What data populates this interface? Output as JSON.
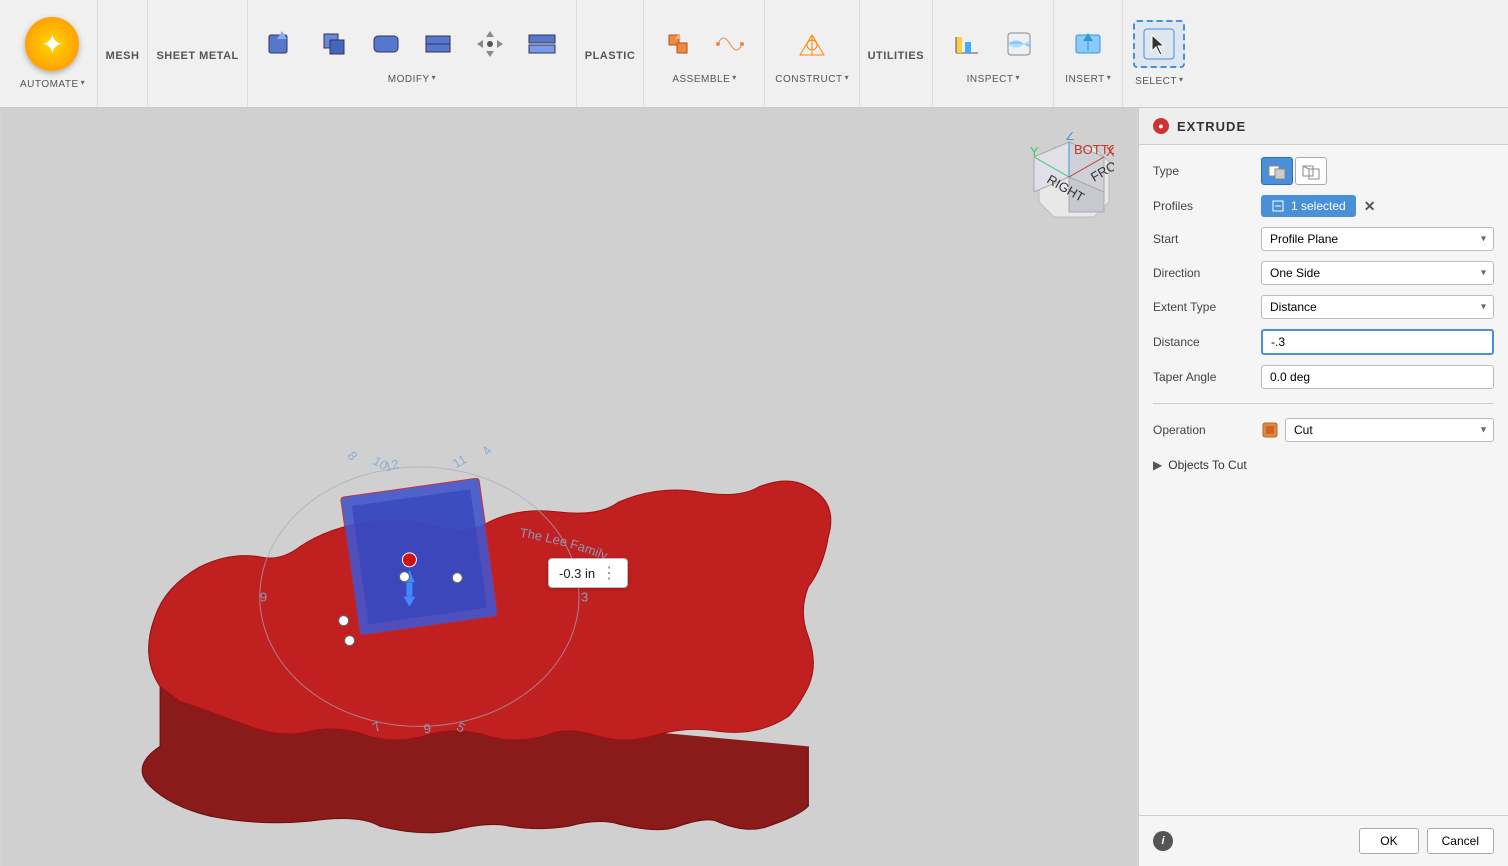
{
  "toolbar": {
    "sections": [
      {
        "id": "automate",
        "label": "AUTOMATE",
        "hasDropdown": true
      },
      {
        "id": "mesh",
        "label": "MESH",
        "buttons": []
      },
      {
        "id": "sheet-metal",
        "label": "SHEET METAL",
        "buttons": []
      },
      {
        "id": "modify",
        "label": "MODIFY",
        "hasDropdown": true,
        "buttons": [
          {
            "id": "mod1",
            "label": ""
          },
          {
            "id": "mod2",
            "label": ""
          },
          {
            "id": "mod3",
            "label": ""
          },
          {
            "id": "mod4",
            "label": ""
          },
          {
            "id": "mod5",
            "label": ""
          },
          {
            "id": "mod6",
            "label": ""
          }
        ]
      },
      {
        "id": "plastic",
        "label": "PLASTIC",
        "buttons": []
      },
      {
        "id": "assemble",
        "label": "ASSEMBLE",
        "hasDropdown": true,
        "buttons": [
          {
            "id": "asm1",
            "label": ""
          },
          {
            "id": "asm2",
            "label": ""
          }
        ]
      },
      {
        "id": "construct",
        "label": "CONSTRUCT",
        "hasDropdown": true,
        "buttons": [
          {
            "id": "con1",
            "label": ""
          }
        ]
      },
      {
        "id": "utilities",
        "label": "UTILITIES",
        "buttons": []
      },
      {
        "id": "inspect",
        "label": "INSPECT",
        "hasDropdown": true,
        "buttons": [
          {
            "id": "ins1",
            "label": ""
          },
          {
            "id": "ins2",
            "label": ""
          }
        ]
      },
      {
        "id": "insert",
        "label": "INSERT",
        "hasDropdown": true,
        "buttons": [
          {
            "id": "ins3",
            "label": ""
          }
        ]
      },
      {
        "id": "select",
        "label": "SELECT",
        "hasDropdown": true,
        "buttons": [
          {
            "id": "sel1",
            "label": ""
          }
        ]
      }
    ]
  },
  "panel": {
    "title": "EXTRUDE",
    "fields": {
      "type": {
        "label": "Type",
        "options": [
          "solid",
          "surface"
        ]
      },
      "profiles": {
        "label": "Profiles",
        "value": "1 selected"
      },
      "start": {
        "label": "Start",
        "value": "Profile Plane"
      },
      "direction": {
        "label": "Direction",
        "value": "One Side"
      },
      "extent_type": {
        "label": "Extent Type",
        "value": "Distance"
      },
      "distance": {
        "label": "Distance",
        "value": "-.3"
      },
      "taper_angle": {
        "label": "Taper Angle",
        "value": "0.0 deg"
      },
      "operation": {
        "label": "Operation",
        "value": "Cut"
      },
      "objects_to_cut": {
        "label": "Objects To Cut"
      }
    },
    "footer": {
      "ok_label": "OK",
      "cancel_label": "Cancel"
    }
  },
  "viewport": {
    "measurement": "-0.3 in",
    "nav_cube": {
      "labels": [
        "BOTTOM",
        "FRONT",
        "RIGHT"
      ]
    }
  }
}
